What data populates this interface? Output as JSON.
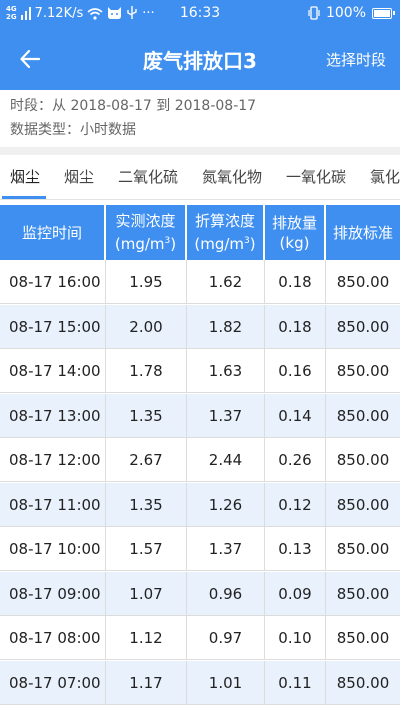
{
  "status_bar": {
    "network_speed": "7.12K/s",
    "time": "16:33",
    "battery": "100%",
    "battery_level": 1.0,
    "signal_top": "4G",
    "signal_bottom": "2G"
  },
  "app_bar": {
    "title": "废气排放口3",
    "right_action": "选择时段"
  },
  "info": {
    "period": "时段：从 2018-08-17 到 2018-08-17",
    "data_type": "数据类型：小时数据"
  },
  "tabs": [
    "烟尘",
    "烟尘",
    "二氧化硫",
    "氮氧化物",
    "一氧化碳",
    "氯化"
  ],
  "active_tab": 0,
  "table": {
    "headers": [
      {
        "line1": "监控时间",
        "line2": ""
      },
      {
        "line1": "实测浓度",
        "line2": "(mg/m",
        "sup": "3",
        "tail": ")"
      },
      {
        "line1": "折算浓度",
        "line2": "(mg/m",
        "sup": "3",
        "tail": ")"
      },
      {
        "line1": "排放量",
        "line2": "(kg)"
      },
      {
        "line1": "排放标准",
        "line2": ""
      }
    ],
    "rows": [
      [
        "08-17 16:00",
        "1.95",
        "1.62",
        "0.18",
        "850.00"
      ],
      [
        "08-17 15:00",
        "2.00",
        "1.82",
        "0.18",
        "850.00"
      ],
      [
        "08-17 14:00",
        "1.78",
        "1.63",
        "0.16",
        "850.00"
      ],
      [
        "08-17 13:00",
        "1.35",
        "1.37",
        "0.14",
        "850.00"
      ],
      [
        "08-17 12:00",
        "2.67",
        "2.44",
        "0.26",
        "850.00"
      ],
      [
        "08-17 11:00",
        "1.35",
        "1.26",
        "0.12",
        "850.00"
      ],
      [
        "08-17 10:00",
        "1.57",
        "1.37",
        "0.13",
        "850.00"
      ],
      [
        "08-17 09:00",
        "1.07",
        "0.96",
        "0.09",
        "850.00"
      ],
      [
        "08-17 08:00",
        "1.12",
        "0.97",
        "0.10",
        "850.00"
      ],
      [
        "08-17 07:00",
        "1.17",
        "1.01",
        "0.11",
        "850.00"
      ]
    ]
  },
  "colors": {
    "primary": "#3f8ff0",
    "row_alt": "#e9f1fc"
  }
}
